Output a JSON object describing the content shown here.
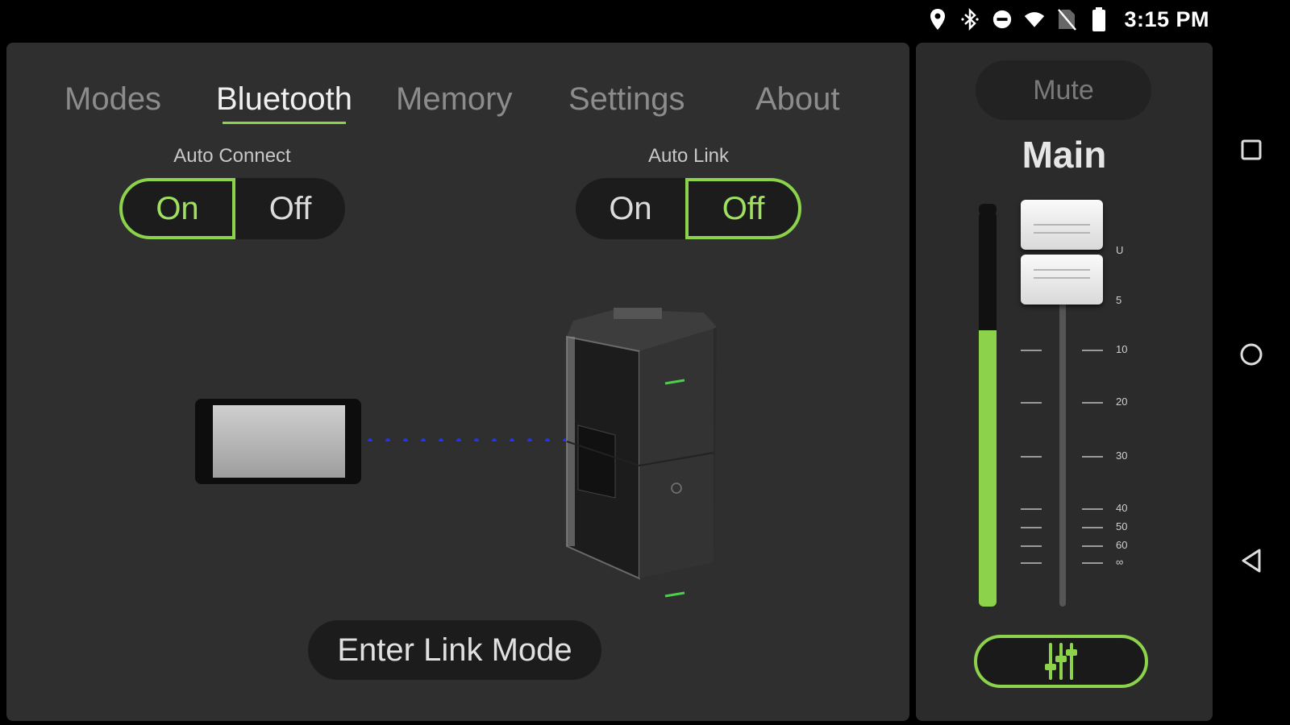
{
  "status_bar": {
    "time": "3:15 PM",
    "icons": [
      "location-icon",
      "bluetooth-icon",
      "do-not-disturb-icon",
      "wifi-icon",
      "no-sim-icon",
      "battery-icon"
    ]
  },
  "tabs": [
    {
      "label": "Modes",
      "active": false
    },
    {
      "label": "Bluetooth",
      "active": true
    },
    {
      "label": "Memory",
      "active": false
    },
    {
      "label": "Settings",
      "active": false
    },
    {
      "label": "About",
      "active": false
    }
  ],
  "auto_connect": {
    "label": "Auto Connect",
    "on_label": "On",
    "off_label": "Off",
    "selected": "On"
  },
  "auto_link": {
    "label": "Auto Link",
    "on_label": "On",
    "off_label": "Off",
    "selected": "Off"
  },
  "enter_link_mode": "Enter Link Mode",
  "mixer": {
    "mute_label": "Mute",
    "channel_label": "Main",
    "meter_level": 0.7,
    "fader_scale": [
      "U",
      "5",
      "10",
      "20",
      "30",
      "40",
      "50",
      "60",
      "∞"
    ],
    "fader_position_label": "U"
  },
  "colors": {
    "accent": "#8cd24a",
    "panel": "#2f2f2f",
    "link_dots": "#2233ff"
  }
}
